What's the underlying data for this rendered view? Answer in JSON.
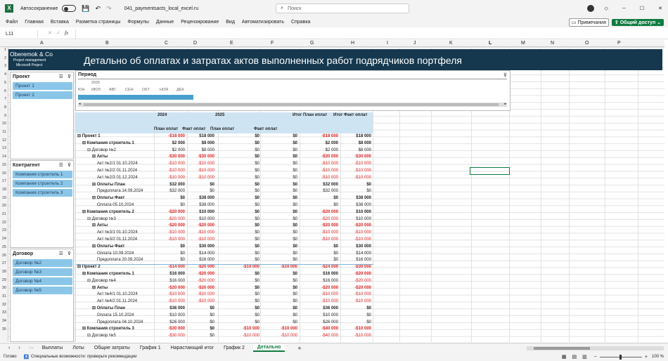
{
  "app": {
    "autosave_label": "Автосохранение",
    "filename": "041_paymentsacts_local_excel.ru",
    "search_placeholder": "Поиск",
    "comments_label": "Примечания",
    "share_label": "Общий доступ"
  },
  "menu": [
    "Файл",
    "Главная",
    "Вставка",
    "Разметка страницы",
    "Формулы",
    "Данные",
    "Рецензирование",
    "Вид",
    "Автоматизировать",
    "Справка"
  ],
  "formula": {
    "namebox": "L11",
    "fx": "fx"
  },
  "columns": [
    "A",
    "B",
    "C",
    "D",
    "E",
    "F",
    "G",
    "H",
    "I",
    "J",
    "K",
    "L",
    "M",
    "N",
    "O",
    "P"
  ],
  "rows": [
    "1",
    "2",
    "3",
    "4",
    "5",
    "6",
    "7",
    "8",
    "9",
    "10",
    "11",
    "12",
    "13",
    "14",
    "15",
    "16",
    "17",
    "18",
    "19",
    "20",
    "21",
    "22",
    "23",
    "24",
    "25",
    "26",
    "27",
    "28",
    "29",
    "30",
    "31",
    "32",
    "33",
    "34",
    "35"
  ],
  "banner": {
    "company": "Oberemok & Co",
    "sub1": "Project management",
    "sub2": "Microsoft Project",
    "title": "Детально об оплатах и затратах актов выполненных работ подрядчиков портфеля"
  },
  "slicers": {
    "project": {
      "title": "Проект",
      "items": [
        "Проект 1",
        "Проект 2"
      ]
    },
    "contractor": {
      "title": "Контрагент",
      "items": [
        "Компания строитель 1",
        "Компания строитель 2",
        "Компания строитель 3"
      ]
    },
    "contract": {
      "title": "Договор",
      "items": [
        "Договор №2",
        "Договор №3",
        "Договор №4",
        "Договор №5"
      ]
    }
  },
  "timeline": {
    "title": "Период",
    "year": "2025",
    "months": [
      "ЮН",
      "ИЮЛ",
      "АВГ",
      "СЕН",
      "ОКТ",
      "НОЯ",
      "ДЕК"
    ]
  },
  "pivot": {
    "h_2024": "2024",
    "h_2025": "2025",
    "h_total_plan": "Итог План оплат",
    "h_total_fact": "Итог Факт оплат",
    "h_plan": "План оплат",
    "h_fact": "Факт оплат",
    "h_plan2": "План оплат",
    "h_fact2": "Факт оплат",
    "rows": [
      {
        "label": "⊟ Проект 1",
        "ind": 0,
        "b": true,
        "v": [
          "-$18 000",
          "$18 000",
          "$0",
          "$0",
          "-$18 000",
          "$18 000"
        ]
      },
      {
        "label": "⊟ Компания строитель 1",
        "ind": 1,
        "b": true,
        "v": [
          "$2 000",
          "$8 000",
          "$0",
          "$0",
          "$2 000",
          "$8 000"
        ]
      },
      {
        "label": "⊟ Договор №2",
        "ind": 2,
        "b": false,
        "v": [
          "$2 000",
          "$8 000",
          "$0",
          "$0",
          "$2 000",
          "$8 000"
        ]
      },
      {
        "label": "⊟ Акты",
        "ind": 3,
        "b": true,
        "v": [
          "-$30 000",
          "-$30 000",
          "$0",
          "$0",
          "-$30 000",
          "-$30 000"
        ]
      },
      {
        "label": "Акт №2/1 01.10.2024",
        "ind": 4,
        "b": false,
        "v": [
          "-$10 000",
          "-$10 000",
          "$0",
          "$0",
          "-$10 000",
          "-$10 000"
        ]
      },
      {
        "label": "Акт №2/2 01.11.2024",
        "ind": 4,
        "b": false,
        "v": [
          "-$10 000",
          "-$10 000",
          "$0",
          "$0",
          "-$10 000",
          "-$10 000"
        ]
      },
      {
        "label": "Акт №2/3 01.12.2024",
        "ind": 4,
        "b": false,
        "v": [
          "-$10 000",
          "-$10 000",
          "$0",
          "$0",
          "-$10 000",
          "-$10 000"
        ]
      },
      {
        "label": "⊟ Оплаты План",
        "ind": 3,
        "b": true,
        "v": [
          "$32 000",
          "$0",
          "$0",
          "$0",
          "$32 000",
          "$0"
        ]
      },
      {
        "label": "Предоплата 14.09.2024",
        "ind": 4,
        "b": false,
        "v": [
          "$32 000",
          "$0",
          "$0",
          "$0",
          "$32 000",
          "$0"
        ]
      },
      {
        "label": "⊟ Оплаты Факт",
        "ind": 3,
        "b": true,
        "v": [
          "$0",
          "$38 000",
          "$0",
          "$0",
          "$0",
          "$38 000"
        ]
      },
      {
        "label": "Оплата 05.10.2024",
        "ind": 4,
        "b": false,
        "v": [
          "$0",
          "$38 000",
          "$0",
          "$0",
          "$0",
          "$38 000"
        ]
      },
      {
        "label": "⊟ Компания строитель 2",
        "ind": 1,
        "b": true,
        "v": [
          "-$20 000",
          "$10 000",
          "$0",
          "$0",
          "-$20 000",
          "$10 000"
        ]
      },
      {
        "label": "⊟ Договор №3",
        "ind": 2,
        "b": false,
        "v": [
          "-$20 000",
          "$10 000",
          "$0",
          "$0",
          "-$20 000",
          "$10 000"
        ]
      },
      {
        "label": "⊟ Акты",
        "ind": 3,
        "b": true,
        "v": [
          "-$20 000",
          "-$20 000",
          "$0",
          "$0",
          "-$20 000",
          "-$20 000"
        ]
      },
      {
        "label": "Акт №3/1 01.10.2024",
        "ind": 4,
        "b": false,
        "v": [
          "-$10 000",
          "-$10 000",
          "$0",
          "$0",
          "-$10 000",
          "-$10 000"
        ]
      },
      {
        "label": "Акт №3/2 01.11.2024",
        "ind": 4,
        "b": false,
        "v": [
          "-$10 000",
          "-$10 000",
          "$0",
          "$0",
          "-$10 000",
          "-$10 000"
        ]
      },
      {
        "label": "⊟ Оплаты Факт",
        "ind": 3,
        "b": true,
        "v": [
          "$0",
          "$30 000",
          "$0",
          "$0",
          "$0",
          "$30 000"
        ]
      },
      {
        "label": "Оплата 10.09.2024",
        "ind": 4,
        "b": false,
        "v": [
          "$0",
          "$14 000",
          "$0",
          "$0",
          "$0",
          "$14 000"
        ]
      },
      {
        "label": "Предоплата 20.09.2024",
        "ind": 4,
        "b": false,
        "v": [
          "$0",
          "$16 000",
          "$0",
          "$0",
          "$0",
          "$16 000"
        ]
      },
      {
        "label": "⊟ Проект 2",
        "ind": 0,
        "b": true,
        "v": [
          "-$14 000",
          "-$20 000",
          "-$10 000",
          "-$10 000",
          "-$24 000",
          "-$30 000"
        ]
      },
      {
        "label": "⊟ Компания строитель 1",
        "ind": 1,
        "b": true,
        "v": [
          "$16 000",
          "-$20 000",
          "$0",
          "$0",
          "$16 000",
          "-$20 000"
        ]
      },
      {
        "label": "⊟ Договор №4",
        "ind": 2,
        "b": false,
        "v": [
          "$16 000",
          "-$20 000",
          "$0",
          "$0",
          "$16 000",
          "-$20 000"
        ]
      },
      {
        "label": "⊟ Акты",
        "ind": 3,
        "b": true,
        "v": [
          "-$20 000",
          "-$20 000",
          "$0",
          "$0",
          "-$20 000",
          "-$20 000"
        ]
      },
      {
        "label": "Акт №4/1 01.10.2024",
        "ind": 4,
        "b": false,
        "v": [
          "-$10 000",
          "-$10 000",
          "$0",
          "$0",
          "-$10 000",
          "-$10 000"
        ]
      },
      {
        "label": "Акт №4/2 01.11.2024",
        "ind": 4,
        "b": false,
        "v": [
          "-$10 000",
          "-$10 000",
          "$0",
          "$0",
          "-$10 000",
          "-$10 000"
        ]
      },
      {
        "label": "⊟ Оплаты План",
        "ind": 3,
        "b": true,
        "v": [
          "$36 000",
          "$0",
          "$0",
          "$0",
          "$36 000",
          "$0"
        ]
      },
      {
        "label": "Оплата 15.10.2024",
        "ind": 4,
        "b": false,
        "v": [
          "$10 000",
          "$0",
          "$0",
          "$0",
          "$10 000",
          "$0"
        ]
      },
      {
        "label": "Предоплата 04.10.2024",
        "ind": 4,
        "b": false,
        "v": [
          "$26 000",
          "$0",
          "$0",
          "$0",
          "$26 000",
          "$0"
        ]
      },
      {
        "label": "⊟ Компания строитель 3",
        "ind": 1,
        "b": true,
        "v": [
          "-$30 000",
          "$0",
          "-$10 000",
          "-$10 000",
          "-$40 000",
          "-$10 000"
        ]
      },
      {
        "label": "⊟ Договор №5",
        "ind": 2,
        "b": false,
        "v": [
          "-$30 000",
          "$0",
          "-$10 000",
          "-$10 000",
          "-$40 000",
          "-$10 000"
        ]
      }
    ]
  },
  "sheets": [
    "Выплаты",
    "Лоты",
    "Общие затраты",
    "График 1",
    "Нарастающий итог",
    "График 2",
    "Детально"
  ],
  "active_sheet": "Детально",
  "status": {
    "ready": "Готово",
    "accessibility": "Специальные возможности: проверьте рекомендации",
    "zoom": "100 %"
  }
}
